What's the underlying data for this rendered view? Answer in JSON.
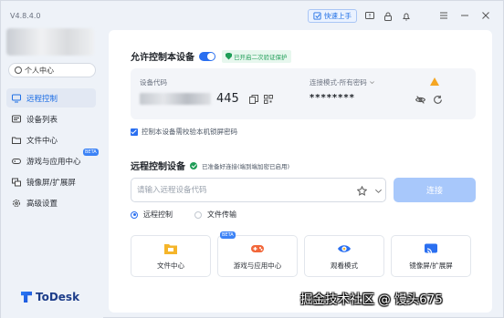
{
  "app": {
    "version": "V4.8.4.0",
    "brand": "ToDesk"
  },
  "sidebar": {
    "personal_center": "个人中心",
    "items": [
      {
        "label": "远程控制",
        "icon": "monitor-icon",
        "active": true
      },
      {
        "label": "设备列表",
        "icon": "device-list-icon"
      },
      {
        "label": "文件中心",
        "icon": "folder-icon"
      },
      {
        "label": "游戏与应用中心",
        "icon": "gamepad-icon",
        "badge": "BETA"
      },
      {
        "label": "镜像屏/扩展屏",
        "icon": "screen-mirror-icon"
      },
      {
        "label": "高级设置",
        "icon": "gear-icon"
      }
    ]
  },
  "topbar": {
    "quick_start": "快速上手"
  },
  "allow_control": {
    "title": "允许控制本设备",
    "enabled": true,
    "badge": "已开启二次验证保护"
  },
  "device": {
    "code_label": "设备代码",
    "code_suffix": "445",
    "mode_label": "连接模式-所有密码",
    "password": "********"
  },
  "lock_check": {
    "label": "控制本设备需校验本机锁屏密码",
    "checked": true
  },
  "remote": {
    "title": "远程控制设备",
    "status": "已准备好连接(端到端加密已启用)",
    "input_placeholder": "请输入远程设备代码",
    "connect": "连接",
    "modes": [
      {
        "label": "远程控制",
        "selected": true
      },
      {
        "label": "文件传输",
        "selected": false
      }
    ]
  },
  "tiles": [
    {
      "label": "文件中心",
      "icon": "folder-icon",
      "color": "#f5b52a"
    },
    {
      "label": "游戏与应用中心",
      "icon": "gamepad-icon",
      "color": "#f2673a",
      "badge": "BETA"
    },
    {
      "label": "观看模式",
      "icon": "eye-icon",
      "color": "#2a6ff0"
    },
    {
      "label": "镜像屏/扩展屏",
      "icon": "cast-icon",
      "color": "#2a6ff0"
    }
  ],
  "watermark": "掘金技术社区 @ 馒头675",
  "colors": {
    "accent": "#2a6ff0",
    "success": "#1f9d57",
    "warning": "#f5a623"
  }
}
